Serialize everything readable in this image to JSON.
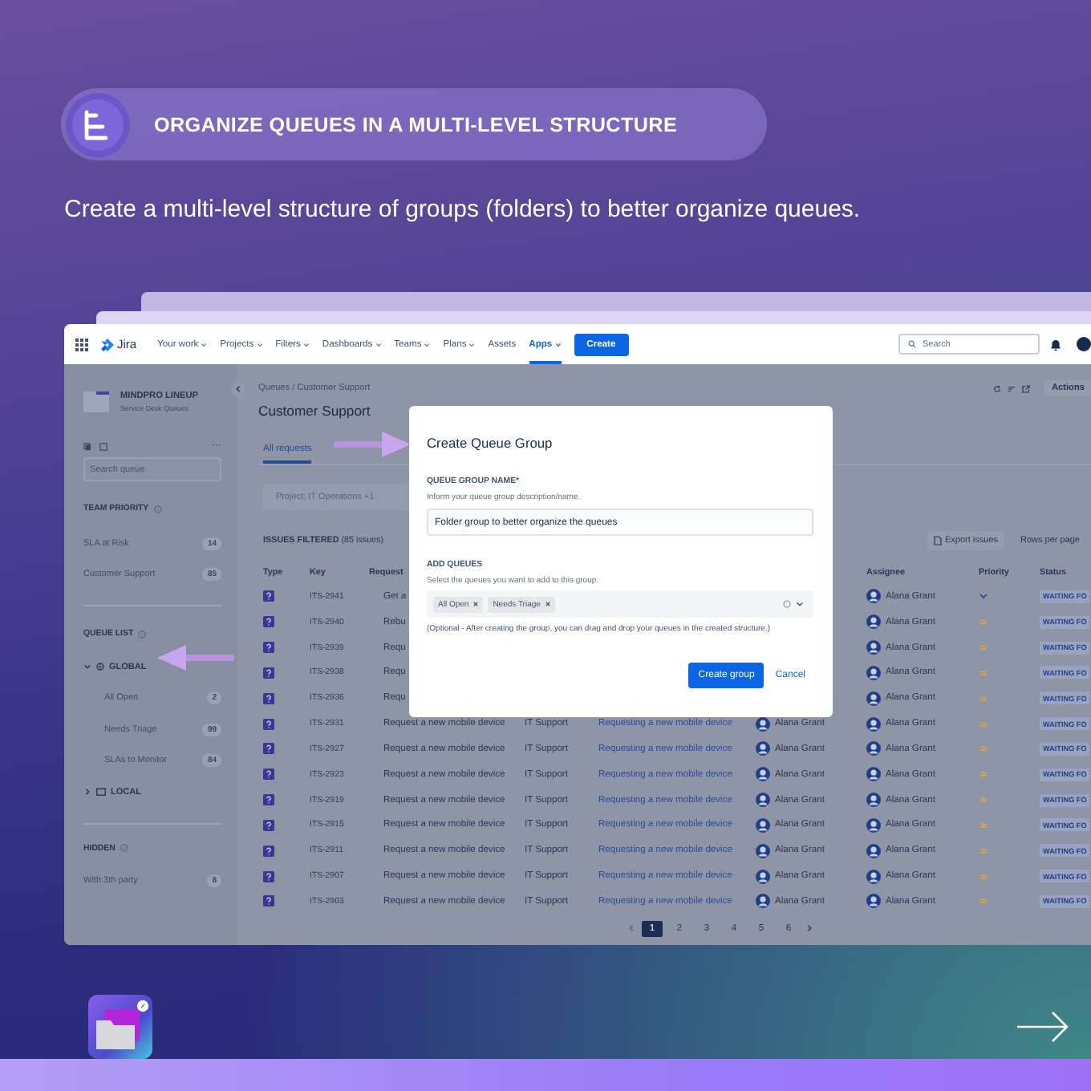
{
  "slide": {
    "title": "ORGANIZE QUEUES IN A MULTI-LEVEL STRUCTURE",
    "subtitle": "Create a multi-level structure of groups (folders) to better organize queues."
  },
  "app": {
    "nav": {
      "logo": "Jira",
      "items": [
        {
          "label": "Your work",
          "dropdown": true,
          "selected": false
        },
        {
          "label": "Projects",
          "dropdown": true,
          "selected": false
        },
        {
          "label": "Filters",
          "dropdown": true,
          "selected": false
        },
        {
          "label": "Dashboards",
          "dropdown": true,
          "selected": false
        },
        {
          "label": "Teams",
          "dropdown": true,
          "selected": false
        },
        {
          "label": "Plans",
          "dropdown": true,
          "selected": false
        },
        {
          "label": "Assets",
          "dropdown": false,
          "selected": false
        },
        {
          "label": "Apps",
          "dropdown": true,
          "selected": true
        }
      ],
      "create": "Create",
      "search": {
        "placeholder": "Search"
      }
    },
    "sidebar": {
      "project": {
        "name": "MINDPRO LINEUP",
        "subtitle": "Service Desk Queues"
      },
      "more": "···",
      "search": {
        "placeholder": "Search queue"
      },
      "sections": [
        {
          "title": "TEAM PRIORITY",
          "items": [
            {
              "label": "SLA at Risk",
              "count": "14"
            },
            {
              "label": "Customer Support",
              "count": "85"
            }
          ]
        },
        {
          "title": "QUEUE LIST",
          "items": [
            {
              "label": "GLOBAL",
              "kind": "group",
              "expanded": true,
              "children": [
                {
                  "label": "All Open",
                  "count": "2"
                },
                {
                  "label": "Needs Triage",
                  "count": "99"
                },
                {
                  "label": "SLAs to Monitor",
                  "count": "84"
                }
              ]
            },
            {
              "label": "LOCAL",
              "kind": "group",
              "expanded": false
            }
          ]
        },
        {
          "title": "HIDDEN",
          "items": [
            {
              "label": "With 3th party",
              "count": "8"
            }
          ]
        }
      ]
    },
    "main": {
      "breadcrumb": "Queues / Customer Support",
      "title": "Customer Support",
      "actions": "Actions",
      "tabs": [
        {
          "label": "All requests",
          "selected": true
        }
      ],
      "filter": "Project: IT Operations +1",
      "issues_label": "ISSUES FILTERED",
      "issues_count": "(85 issues)",
      "export": "Export issues",
      "rows_per_page": "Rows per page",
      "table": {
        "columns": [
          "Type",
          "Key",
          "Request",
          null,
          null,
          null,
          "Assignee",
          "Priority",
          "Status"
        ],
        "rows": [
          {
            "key": "ITS-2941",
            "request": "Get a",
            "assignee": "Alana Grant",
            "priority": {
              "kind": "low"
            },
            "status": "WAITING FO"
          },
          {
            "key": "ITS-2940",
            "request": "Rebu",
            "assignee": "Alana Grant",
            "priority": {
              "kind": "medium"
            },
            "status": "WAITING FO"
          },
          {
            "key": "ITS-2939",
            "request": "Requ",
            "assignee": "Alana Grant",
            "priority": {
              "kind": "medium"
            },
            "status": "WAITING FO"
          },
          {
            "key": "ITS-2938",
            "request": "Requ",
            "assignee": "Alana Grant",
            "priority": {
              "kind": "medium"
            },
            "status": "WAITING FO"
          },
          {
            "key": "ITS-2936",
            "request": "Requ",
            "assignee": "Alana Grant",
            "priority": {
              "kind": "medium"
            },
            "status": "WAITING FO"
          },
          {
            "key": "ITS-2931",
            "request": "Request a new mobile device",
            "request_type": "IT Support",
            "summary": "Requesting a new mobile device",
            "reporter": "Alana Grant",
            "assignee": "Alana Grant",
            "priority": {
              "kind": "medium"
            },
            "status": "WAITING FO"
          },
          {
            "key": "ITS-2927",
            "request": "Request a new mobile device",
            "request_type": "IT Support",
            "summary": "Requesting a new mobile device",
            "reporter": "Alana Grant",
            "assignee": "Alana Grant",
            "priority": {
              "kind": "medium"
            },
            "status": "WAITING FO"
          },
          {
            "key": "ITS-2923",
            "request": "Request a new mobile device",
            "request_type": "IT Support",
            "summary": "Requesting a new mobile device",
            "reporter": "Alana Grant",
            "assignee": "Alana Grant",
            "priority": {
              "kind": "medium"
            },
            "status": "WAITING FO"
          },
          {
            "key": "ITS-2919",
            "request": "Request a new mobile device",
            "request_type": "IT Support",
            "summary": "Requesting a new mobile device",
            "reporter": "Alana Grant",
            "assignee": "Alana Grant",
            "priority": {
              "kind": "medium"
            },
            "status": "WAITING FO"
          },
          {
            "key": "ITS-2915",
            "request": "Request a new mobile device",
            "request_type": "IT Support",
            "summary": "Requesting a new mobile device",
            "reporter": "Alana Grant",
            "assignee": "Alana Grant",
            "priority": {
              "kind": "medium"
            },
            "status": "WAITING FO"
          },
          {
            "key": "ITS-2911",
            "request": "Request a new mobile device",
            "request_type": "IT Support",
            "summary": "Requesting a new mobile device",
            "reporter": "Alana Grant",
            "assignee": "Alana Grant",
            "priority": {
              "kind": "medium"
            },
            "status": "WAITING FO"
          },
          {
            "key": "ITS-2907",
            "request": "Request a new mobile device",
            "request_type": "IT Support",
            "summary": "Requesting a new mobile device",
            "reporter": "Alana Grant",
            "assignee": "Alana Grant",
            "priority": {
              "kind": "medium"
            },
            "status": "WAITING FO"
          },
          {
            "key": "ITS-2903",
            "request": "Request a new mobile device",
            "request_type": "IT Support",
            "summary": "Requesting a new mobile device",
            "reporter": "Alana Grant",
            "assignee": "Alana Grant",
            "priority": {
              "kind": "medium"
            },
            "status": "WAITING FO"
          }
        ]
      },
      "pagination": [
        {
          "label": "1",
          "selected": true
        },
        {
          "label": "2",
          "selected": false
        },
        {
          "label": "3",
          "selected": false
        },
        {
          "label": "4",
          "selected": false
        },
        {
          "label": "5",
          "selected": false
        },
        {
          "label": "6",
          "selected": false
        }
      ]
    },
    "modal": {
      "title": "Create Queue Group",
      "name_label": "QUEUE GROUP NAME",
      "required_mark": "*",
      "name_help": "Inform your queue group description/name.",
      "name_value": "Folder group to better organize the queues",
      "queues_label": "ADD QUEUES",
      "queues_help": "Select the queues you want to add to this group.",
      "chips": [
        "All Open",
        "Needs Triage"
      ],
      "note": "(Optional - After creating the group, you can drag and drop your queues in the created structure.)",
      "submit": "Create group",
      "cancel": "Cancel"
    }
  }
}
